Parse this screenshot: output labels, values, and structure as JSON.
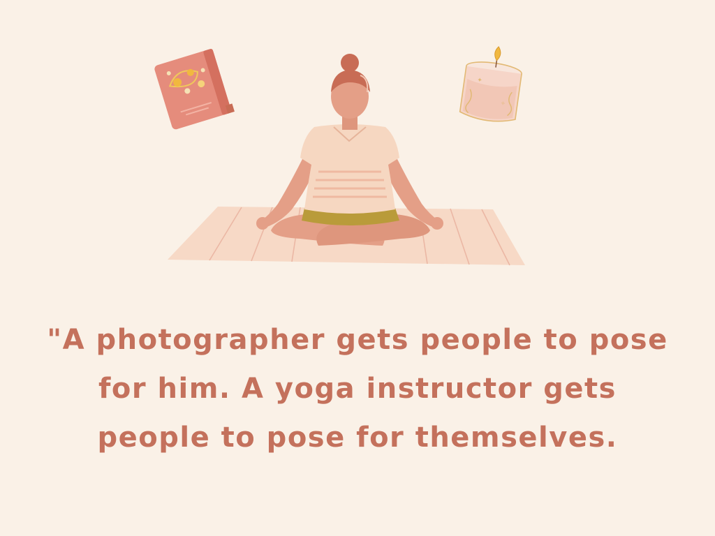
{
  "quote": {
    "lines": [
      "\"A photographer gets people to pose",
      "for him. A yoga instructor gets",
      "people to pose for themselves."
    ]
  },
  "colors": {
    "background": "#FAF1E7",
    "text": "#C4715C",
    "mat": "#F7D9C6",
    "skin": "#E49F87",
    "hair": "#C86C55",
    "shirt": "#F6D7C1",
    "shorts": "#B99B3A",
    "book": "#E58C7C",
    "candle": "#F6D5C8"
  },
  "icons": {
    "book": "book-icon",
    "candle": "candle-icon",
    "figure": "meditating-woman-icon",
    "mat": "yoga-mat-icon"
  }
}
